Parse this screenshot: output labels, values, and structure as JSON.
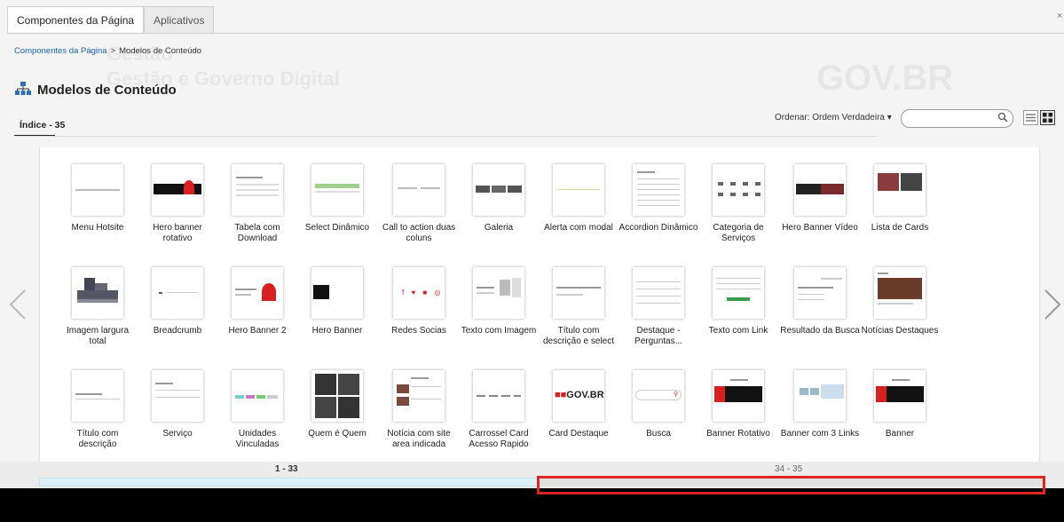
{
  "tabs": [
    {
      "label": "Componentes da Página",
      "active": true
    },
    {
      "label": "Aplicativos",
      "active": false
    }
  ],
  "close_label": "×",
  "breadcrumb": {
    "root": "Componentes da Página",
    "separator": ">",
    "current": "Modelos de Conteúdo"
  },
  "page_title": "Modelos de Conteúdo",
  "background_ghost": {
    "line1": "Gestão",
    "line2": "Gestão e Governo Digital",
    "logo": "GOV.BR"
  },
  "index_tab": "Índice - 35",
  "sort": {
    "label": "Ordenar:",
    "value": "Ordem Verdadeira",
    "caret": "▾"
  },
  "search": {
    "placeholder": ""
  },
  "items": [
    {
      "label": "Menu Hotsite",
      "thumb": "menu"
    },
    {
      "label": "Hero banner rotativo",
      "thumb": "hero-red"
    },
    {
      "label": "Tabela com Download",
      "thumb": "table"
    },
    {
      "label": "Select Dinâmico",
      "thumb": "select-green"
    },
    {
      "label": "Call to action duas coluns",
      "thumb": "cta"
    },
    {
      "label": "Galeria",
      "thumb": "gallery"
    },
    {
      "label": "Alerta com modal",
      "thumb": "alert"
    },
    {
      "label": "Accordion Dinâmico",
      "thumb": "accordion"
    },
    {
      "label": "Categoria de Serviços",
      "thumb": "category"
    },
    {
      "label": "Hero Banner Vídeo",
      "thumb": "hero-video"
    },
    {
      "label": "Lista de Cards",
      "thumb": "cards-list"
    },
    {
      "label": "Imagem largura total",
      "thumb": "image-full"
    },
    {
      "label": "Breadcrumb",
      "thumb": "breadcrumb"
    },
    {
      "label": "Hero Banner 2",
      "thumb": "hero2"
    },
    {
      "label": "Hero Banner",
      "thumb": "hero-black"
    },
    {
      "label": "Redes Socias",
      "thumb": "social"
    },
    {
      "label": "Texto com Imagem",
      "thumb": "text-image"
    },
    {
      "label": "Título com descrição e select",
      "thumb": "title-select"
    },
    {
      "label": "Destaque - Perguntas...",
      "thumb": "faq"
    },
    {
      "label": "Texto com Link",
      "thumb": "text-link"
    },
    {
      "label": "Resultado da Busca",
      "thumb": "search-result"
    },
    {
      "label": "Notícias Destaques",
      "thumb": "news"
    },
    {
      "label": "Título com descrição",
      "thumb": "title-desc"
    },
    {
      "label": "Serviço",
      "thumb": "service"
    },
    {
      "label": "Unidades Vinculadas",
      "thumb": "units"
    },
    {
      "label": "Quem é Quem",
      "thumb": "people"
    },
    {
      "label": "Notícia com site area indicada",
      "thumb": "news-site"
    },
    {
      "label": "Carrossel Card Acesso Rapido",
      "thumb": "carousel-card"
    },
    {
      "label": "Card Destaque",
      "thumb": "govbr",
      "thumb_text": "GOV.BR"
    },
    {
      "label": "Busca",
      "thumb": "search"
    },
    {
      "label": "Banner Rotativo",
      "thumb": "banner-rot"
    },
    {
      "label": "Banner com 3 Links",
      "thumb": "banner3"
    },
    {
      "label": "Banner",
      "thumb": "banner"
    }
  ],
  "pages": [
    {
      "label": "1 - 33",
      "current": true
    },
    {
      "label": "34 - 35",
      "current": false
    }
  ],
  "navigation": {
    "prev": "‹",
    "next": "›"
  },
  "icons": {
    "title": "sitemap-icon",
    "search": "search-icon",
    "list_view": "list-view-icon",
    "grid_view": "grid-view-icon"
  },
  "colors": {
    "link": "#1c5fa8",
    "highlight": "#e02424",
    "govbr_red": "#d7201f"
  }
}
